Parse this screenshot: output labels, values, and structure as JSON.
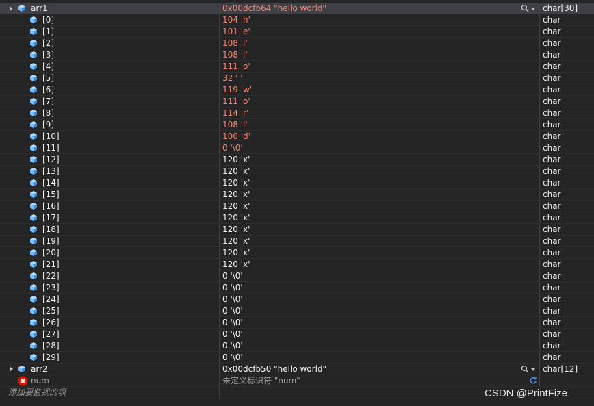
{
  "watch": {
    "arr1": {
      "name": "arr1",
      "value": "0x00dcfb64 \"hello world\"",
      "type": "char[30]"
    },
    "elements": [
      {
        "idx": "[0]",
        "val": "104 'h'",
        "type": "char",
        "changed": true
      },
      {
        "idx": "[1]",
        "val": "101 'e'",
        "type": "char",
        "changed": true
      },
      {
        "idx": "[2]",
        "val": "108 'l'",
        "type": "char",
        "changed": true
      },
      {
        "idx": "[3]",
        "val": "108 'l'",
        "type": "char",
        "changed": true
      },
      {
        "idx": "[4]",
        "val": "111 'o'",
        "type": "char",
        "changed": true
      },
      {
        "idx": "[5]",
        "val": "32 ' '",
        "type": "char",
        "changed": true
      },
      {
        "idx": "[6]",
        "val": "119 'w'",
        "type": "char",
        "changed": true
      },
      {
        "idx": "[7]",
        "val": "111 'o'",
        "type": "char",
        "changed": true
      },
      {
        "idx": "[8]",
        "val": "114 'r'",
        "type": "char",
        "changed": true
      },
      {
        "idx": "[9]",
        "val": "108 'l'",
        "type": "char",
        "changed": true
      },
      {
        "idx": "[10]",
        "val": "100 'd'",
        "type": "char",
        "changed": true
      },
      {
        "idx": "[11]",
        "val": "0 '\\0'",
        "type": "char",
        "changed": true
      },
      {
        "idx": "[12]",
        "val": "120 'x'",
        "type": "char",
        "changed": false
      },
      {
        "idx": "[13]",
        "val": "120 'x'",
        "type": "char",
        "changed": false
      },
      {
        "idx": "[14]",
        "val": "120 'x'",
        "type": "char",
        "changed": false
      },
      {
        "idx": "[15]",
        "val": "120 'x'",
        "type": "char",
        "changed": false
      },
      {
        "idx": "[16]",
        "val": "120 'x'",
        "type": "char",
        "changed": false
      },
      {
        "idx": "[17]",
        "val": "120 'x'",
        "type": "char",
        "changed": false
      },
      {
        "idx": "[18]",
        "val": "120 'x'",
        "type": "char",
        "changed": false
      },
      {
        "idx": "[19]",
        "val": "120 'x'",
        "type": "char",
        "changed": false
      },
      {
        "idx": "[20]",
        "val": "120 'x'",
        "type": "char",
        "changed": false
      },
      {
        "idx": "[21]",
        "val": "120 'x'",
        "type": "char",
        "changed": false
      },
      {
        "idx": "[22]",
        "val": "0 '\\0'",
        "type": "char",
        "changed": false
      },
      {
        "idx": "[23]",
        "val": "0 '\\0'",
        "type": "char",
        "changed": false
      },
      {
        "idx": "[24]",
        "val": "0 '\\0'",
        "type": "char",
        "changed": false
      },
      {
        "idx": "[25]",
        "val": "0 '\\0'",
        "type": "char",
        "changed": false
      },
      {
        "idx": "[26]",
        "val": "0 '\\0'",
        "type": "char",
        "changed": false
      },
      {
        "idx": "[27]",
        "val": "0 '\\0'",
        "type": "char",
        "changed": false
      },
      {
        "idx": "[28]",
        "val": "0 '\\0'",
        "type": "char",
        "changed": false
      },
      {
        "idx": "[29]",
        "val": "0 '\\0'",
        "type": "char",
        "changed": false
      }
    ],
    "arr2": {
      "name": "arr2",
      "value": "0x00dcfb50 \"hello world\"",
      "type": "char[12]"
    },
    "num": {
      "name": "num",
      "value": "未定义标识符 \"num\""
    },
    "add_watch_placeholder": "添加要监视的项"
  },
  "watermark": "CSDN @PrintFize",
  "colors": {
    "changed_value": "#f48771",
    "normal_value": "#f1f1f1",
    "background": "#252526",
    "selected_row": "#3f3f46",
    "cube_icon": "#75beff",
    "error_icon": "#e51400"
  }
}
